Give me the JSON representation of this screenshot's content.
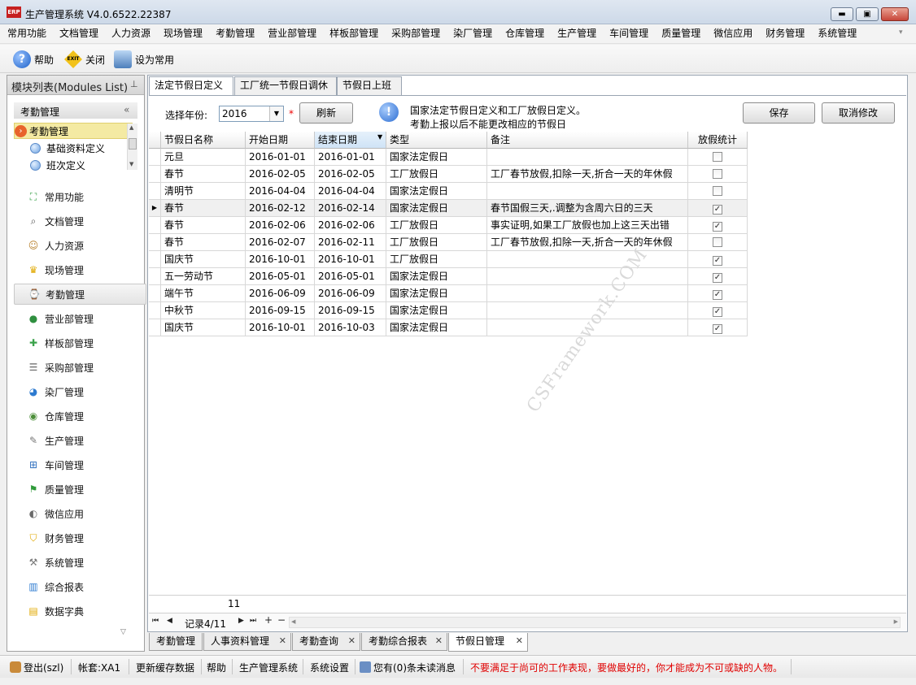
{
  "window": {
    "title": "生产管理系统 V4.0.6522.22387",
    "logo_text": "ERP",
    "min": "▬",
    "max": "▣",
    "close": "✕"
  },
  "menu": [
    "常用功能",
    "文档管理",
    "人力资源",
    "现场管理",
    "考勤管理",
    "营业部管理",
    "样板部管理",
    "采购部管理",
    "染厂管理",
    "仓库管理",
    "生产管理",
    "车间管理",
    "质量管理",
    "微信应用",
    "财务管理",
    "系统管理"
  ],
  "toolbar": {
    "help": {
      "label": "帮助",
      "icon": "help-icon"
    },
    "close": {
      "label": "关闭",
      "icon": "exit-icon",
      "icon_text": "EXIT"
    },
    "favorite": {
      "label": "设为常用",
      "icon": "favorite-icon"
    }
  },
  "left_panel": {
    "title": "模块列表(Modules List)",
    "pin": "ᵖ",
    "module_header": "考勤管理",
    "collapse": "«",
    "tree": [
      {
        "label": "考勤管理",
        "type": "root"
      },
      {
        "label": "基础资料定义",
        "type": "child"
      },
      {
        "label": "班次定义",
        "type": "child"
      }
    ],
    "nav_items": [
      {
        "label": "常用功能",
        "icon": "common-functions-icon",
        "glyph": "⛶",
        "color": "#3aa24a"
      },
      {
        "label": "文档管理",
        "icon": "document-icon",
        "glyph": "⌕",
        "color": "#555"
      },
      {
        "label": "人力资源",
        "icon": "people-icon",
        "glyph": "☺",
        "color": "#b9822f"
      },
      {
        "label": "现场管理",
        "icon": "crown-icon",
        "glyph": "♛",
        "color": "#e0a800"
      },
      {
        "label": "考勤管理",
        "icon": "attendance-icon",
        "glyph": "⌚",
        "color": "#555"
      },
      {
        "label": "营业部管理",
        "icon": "globe-icon",
        "glyph": "●",
        "color": "#2f8f3f"
      },
      {
        "label": "样板部管理",
        "icon": "puzzle-icon",
        "glyph": "✚",
        "color": "#3aa24a"
      },
      {
        "label": "采购部管理",
        "icon": "list-icon",
        "glyph": "☰",
        "color": "#666"
      },
      {
        "label": "染厂管理",
        "icon": "pie-chart-icon",
        "glyph": "◕",
        "color": "#2e7bd0"
      },
      {
        "label": "仓库管理",
        "icon": "warehouse-icon",
        "glyph": "◉",
        "color": "#4d8f3a"
      },
      {
        "label": "生产管理",
        "icon": "wrench-icon",
        "glyph": "✎",
        "color": "#777"
      },
      {
        "label": "车间管理",
        "icon": "org-chart-icon",
        "glyph": "⊞",
        "color": "#2e6fbf"
      },
      {
        "label": "质量管理",
        "icon": "flag-icon",
        "glyph": "⚑",
        "color": "#2f9a3a"
      },
      {
        "label": "微信应用",
        "icon": "wechat-icon",
        "glyph": "◐",
        "color": "#6a6a6a"
      },
      {
        "label": "财务管理",
        "icon": "shield-icon",
        "glyph": "⛉",
        "color": "#e0a800"
      },
      {
        "label": "系统管理",
        "icon": "tools-icon",
        "glyph": "⚒",
        "color": "#777"
      },
      {
        "label": "综合报表",
        "icon": "bar-chart-icon",
        "glyph": "▥",
        "color": "#2e7bd0"
      },
      {
        "label": "数据字典",
        "icon": "dictionary-icon",
        "glyph": "▤",
        "color": "#e0a800"
      }
    ],
    "more": "▽",
    "selected_index": 4
  },
  "sub_tabs": [
    "法定节假日定义",
    "工厂统一节假日调休",
    "节假日上班"
  ],
  "filters": {
    "year_label": "选择年份:",
    "year_value": "2016",
    "required_mark": "*",
    "refresh": "刷新",
    "info_line1": "国家法定节假日定义和工厂放假日定义。",
    "info_line2": "考勤上报以后不能更改相应的节假日",
    "save": "保存",
    "cancel": "取消修改"
  },
  "grid": {
    "columns": [
      "节假日名称",
      "开始日期",
      "结束日期",
      "类型",
      "备注",
      "放假统计"
    ],
    "rows": [
      {
        "name": "元旦",
        "start": "2016-01-01",
        "end": "2016-01-01",
        "type": "国家法定假日",
        "note": "",
        "counted": false
      },
      {
        "name": "春节",
        "start": "2016-02-05",
        "end": "2016-02-05",
        "type": "工厂放假日",
        "note": "工厂春节放假,扣除一天,折合一天的年休假",
        "counted": false
      },
      {
        "name": "清明节",
        "start": "2016-04-04",
        "end": "2016-04-04",
        "type": "国家法定假日",
        "note": "",
        "counted": false
      },
      {
        "name": "春节",
        "start": "2016-02-12",
        "end": "2016-02-14",
        "type": "国家法定假日",
        "note": "春节国假三天,.调整为含周六日的三天",
        "counted": true
      },
      {
        "name": "春节",
        "start": "2016-02-06",
        "end": "2016-02-06",
        "type": "工厂放假日",
        "note": "事实证明,如果工厂放假也加上这三天出错",
        "counted": true
      },
      {
        "name": "春节",
        "start": "2016-02-07",
        "end": "2016-02-11",
        "type": "工厂放假日",
        "note": "工厂春节放假,扣除一天,折合一天的年休假",
        "counted": false
      },
      {
        "name": "国庆节",
        "start": "2016-10-01",
        "end": "2016-10-01",
        "type": "工厂放假日",
        "note": "",
        "counted": true
      },
      {
        "name": "五一劳动节",
        "start": "2016-05-01",
        "end": "2016-05-01",
        "type": "国家法定假日",
        "note": "",
        "counted": true
      },
      {
        "name": "端午节",
        "start": "2016-06-09",
        "end": "2016-06-09",
        "type": "国家法定假日",
        "note": "",
        "counted": true
      },
      {
        "name": "中秋节",
        "start": "2016-09-15",
        "end": "2016-09-15",
        "type": "国家法定假日",
        "note": "",
        "counted": true
      },
      {
        "name": "国庆节",
        "start": "2016-10-01",
        "end": "2016-10-03",
        "type": "国家法定假日",
        "note": "",
        "counted": true
      }
    ],
    "current_row": 3,
    "total": "11",
    "record_text": "记录4/11",
    "watermark": "CSFramework.COM"
  },
  "doc_tabs": [
    {
      "label": "考勤管理",
      "closable": false
    },
    {
      "label": "人事资料管理",
      "closable": true
    },
    {
      "label": "考勤查询",
      "closable": true
    },
    {
      "label": "考勤综合报表",
      "closable": true
    },
    {
      "label": "节假日管理",
      "closable": true,
      "active": true
    }
  ],
  "status_bar": {
    "logout": "登出(szl)",
    "account": "帐套:XA1",
    "refresh_cache": "更新缓存数据",
    "help": "帮助",
    "system": "生产管理系统",
    "settings": "系统设置",
    "messages": "您有(0)条未读消息",
    "slogan": "不要满足于尚可的工作表现，要做最好的，你才能成为不可或缺的人物。"
  }
}
